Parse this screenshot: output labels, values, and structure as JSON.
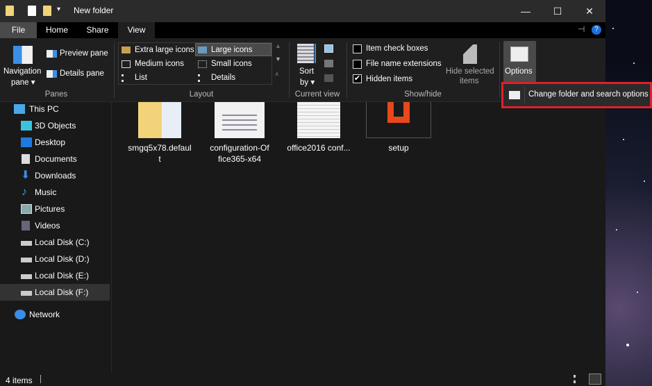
{
  "window": {
    "title": "New folder",
    "minimize": "—",
    "maximize": "☐",
    "close": "✕"
  },
  "tabs": [
    {
      "label": "File"
    },
    {
      "label": "Home"
    },
    {
      "label": "Share"
    },
    {
      "label": "View"
    }
  ],
  "ribbon": {
    "panes": {
      "label": "Panes",
      "navigation_pane": "Navigation",
      "navigation_pane2": "pane ▾",
      "preview_pane": "Preview pane",
      "details_pane": "Details pane"
    },
    "layout": {
      "label": "Layout",
      "items": [
        "Extra large icons",
        "Large icons",
        "Medium icons",
        "Small icons",
        "List",
        "Details"
      ],
      "selected": "Large icons"
    },
    "current_view": {
      "label": "Current view",
      "sort_by": "Sort",
      "sort_by2": "by ▾"
    },
    "show_hide": {
      "label": "Show/hide",
      "item_check_boxes": "Item check boxes",
      "item_check_boxes_checked": false,
      "file_name_extensions": "File name extensions",
      "file_name_extensions_checked": false,
      "hidden_items": "Hidden items",
      "hidden_items_checked": true,
      "hide_selected": "Hide selected",
      "hide_selected2": "items"
    },
    "options": {
      "label": "Options",
      "menu_item": "Change folder and search options"
    }
  },
  "sidebar": {
    "items": [
      {
        "label": "This PC",
        "icon": "computer-icon"
      },
      {
        "label": "3D Objects",
        "icon": "cube-icon"
      },
      {
        "label": "Desktop",
        "icon": "desktop-icon"
      },
      {
        "label": "Documents",
        "icon": "documents-icon"
      },
      {
        "label": "Downloads",
        "icon": "download-arrow-icon"
      },
      {
        "label": "Music",
        "icon": "music-note-icon"
      },
      {
        "label": "Pictures",
        "icon": "pictures-icon"
      },
      {
        "label": "Videos",
        "icon": "videos-icon"
      },
      {
        "label": "Local Disk (C:)",
        "icon": "drive-icon"
      },
      {
        "label": "Local Disk (D:)",
        "icon": "drive-icon"
      },
      {
        "label": "Local Disk (E:)",
        "icon": "drive-icon"
      },
      {
        "label": "Local Disk (F:)",
        "icon": "drive-icon",
        "selected": true
      },
      {
        "label": "Network",
        "icon": "network-icon"
      }
    ]
  },
  "files": [
    {
      "line1": "smgq5x78.defaul",
      "line2": "t"
    },
    {
      "line1": "configuration-Of",
      "line2": "fice365-x64"
    },
    {
      "line1": "office2016 conf...",
      "line2": ""
    },
    {
      "line1": "setup",
      "line2": ""
    }
  ],
  "status": {
    "count": "4 items"
  }
}
